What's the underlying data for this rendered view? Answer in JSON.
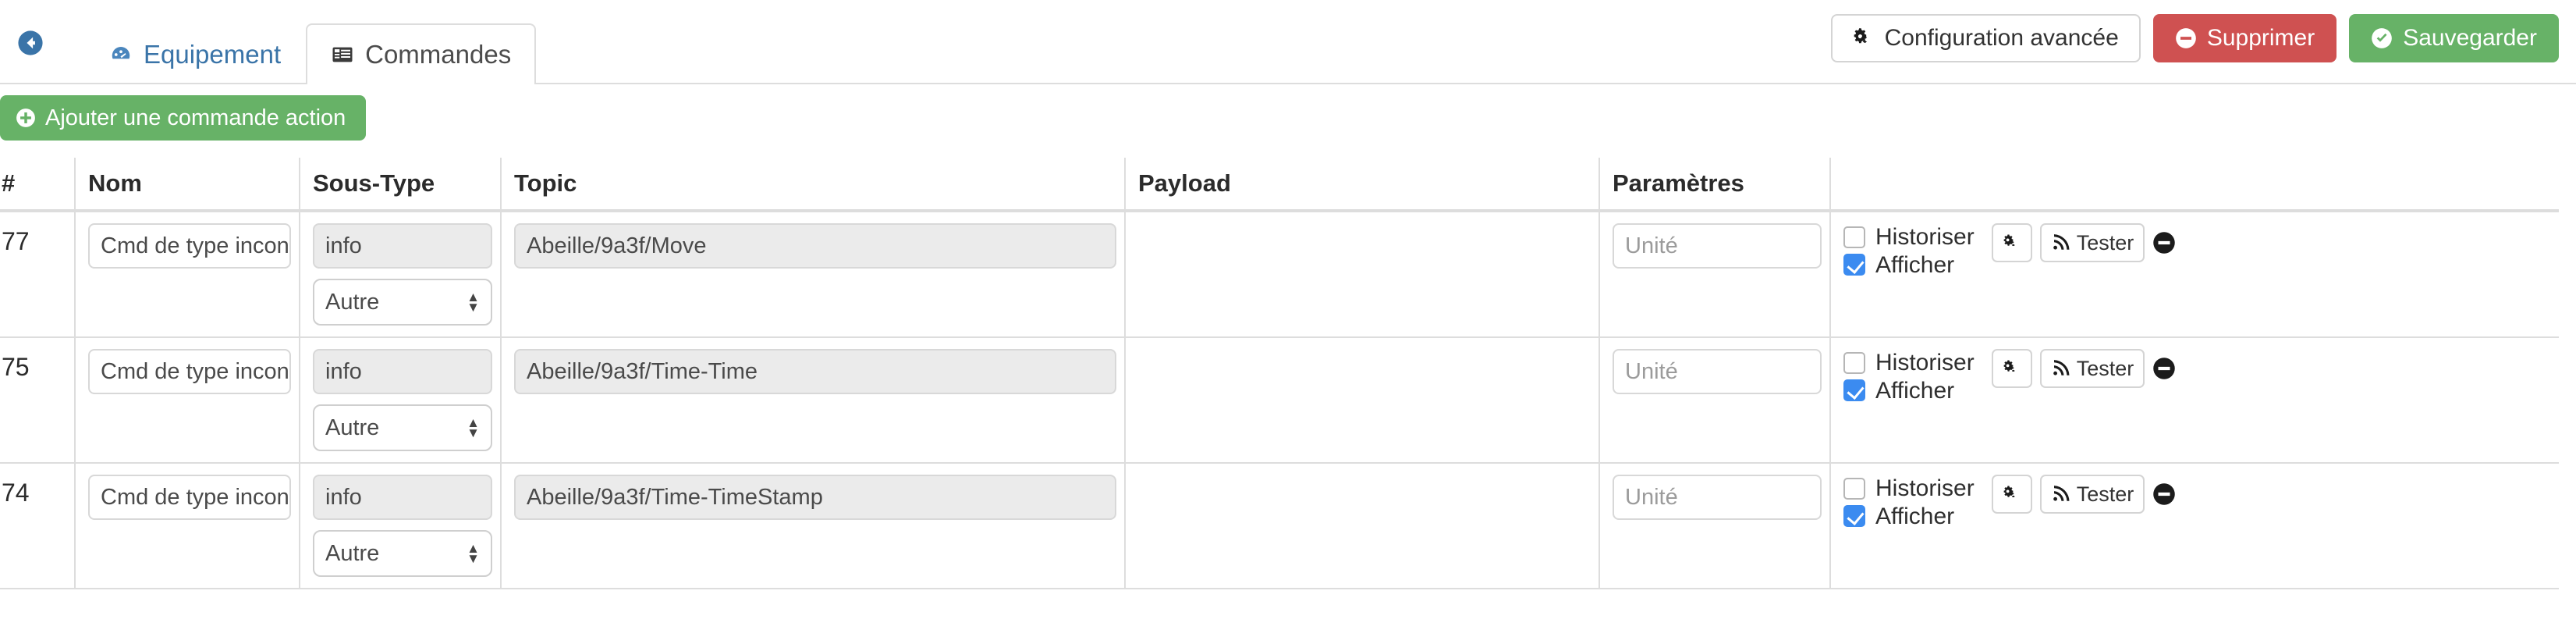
{
  "header": {
    "back_icon": "arrow-circle-left-icon",
    "tabs": [
      {
        "label": "Equipement",
        "icon": "dashboard-icon",
        "active": false
      },
      {
        "label": "Commandes",
        "icon": "list-alt-icon",
        "active": true
      }
    ],
    "actions": [
      {
        "label": "Configuration avancée",
        "icon": "cogs-icon",
        "style": "default"
      },
      {
        "label": "Supprimer",
        "icon": "minus-circle-icon",
        "style": "danger"
      },
      {
        "label": "Sauvegarder",
        "icon": "check-circle-icon",
        "style": "success"
      }
    ]
  },
  "toolbar": {
    "add_action_label": "Ajouter une commande action",
    "add_icon": "plus-circle-icon"
  },
  "table": {
    "columns": [
      "#",
      "Nom",
      "Sous-Type",
      "Topic",
      "Payload",
      "Paramètres",
      ""
    ],
    "row_labels": {
      "historiser": "Historiser",
      "afficher": "Afficher",
      "tester": "Tester",
      "config_icon": "cogs-icon",
      "test_icon": "rss-signal-icon",
      "delete_icon": "minus-circle-filled-icon"
    },
    "unit_placeholder": "Unité",
    "rows": [
      {
        "id": "77",
        "nom": "Cmd de type inconnu",
        "sous_type": "info",
        "sous_type_select": "Autre",
        "topic": "Abeille/9a3f/Move",
        "payload": "",
        "unite": "",
        "historiser": false,
        "afficher": true
      },
      {
        "id": "75",
        "nom": "Cmd de type inconnu",
        "sous_type": "info",
        "sous_type_select": "Autre",
        "topic": "Abeille/9a3f/Time-Time",
        "payload": "",
        "unite": "",
        "historiser": false,
        "afficher": true
      },
      {
        "id": "74",
        "nom": "Cmd de type inconnu",
        "sous_type": "info",
        "sous_type_select": "Autre",
        "topic": "Abeille/9a3f/Time-TimeStamp",
        "payload": "",
        "unite": "",
        "historiser": false,
        "afficher": true
      }
    ]
  },
  "colors": {
    "link_blue": "#3a74a8",
    "danger_red": "#cf5151",
    "success_green": "#67b267",
    "checkbox_blue": "#3b8bf0",
    "border_grey": "#dddddd"
  }
}
